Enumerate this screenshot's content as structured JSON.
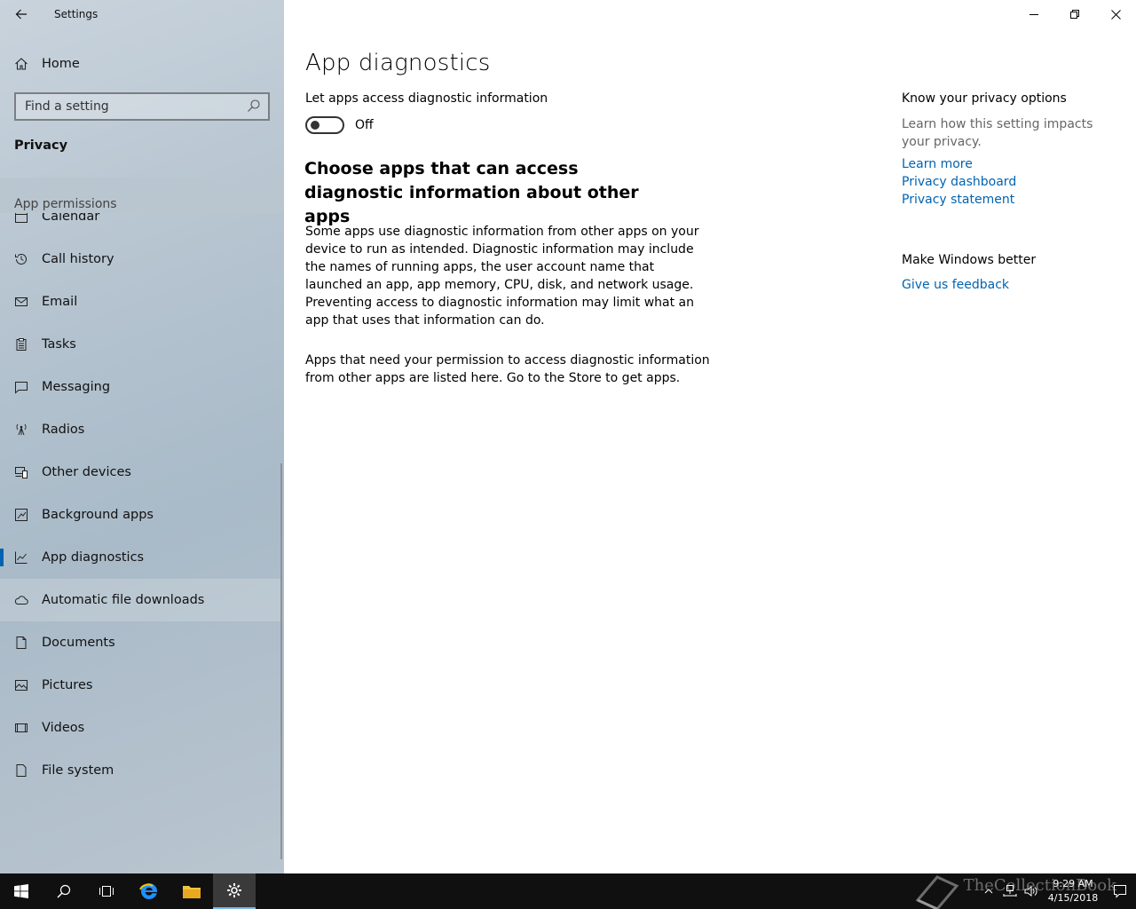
{
  "window": {
    "title": "Settings",
    "controls": {
      "minimize": "minimize-icon",
      "restore": "restore-icon",
      "close": "close-icon"
    }
  },
  "sidebar": {
    "home_label": "Home",
    "search_placeholder": "Find a setting",
    "section_title": "Privacy",
    "group_title": "App permissions",
    "items": [
      {
        "label": "Calendar",
        "icon": "calendar-icon"
      },
      {
        "label": "Call history",
        "icon": "history-icon"
      },
      {
        "label": "Email",
        "icon": "mail-icon"
      },
      {
        "label": "Tasks",
        "icon": "clipboard-icon"
      },
      {
        "label": "Messaging",
        "icon": "chat-icon"
      },
      {
        "label": "Radios",
        "icon": "antenna-icon"
      },
      {
        "label": "Other devices",
        "icon": "devices-icon"
      },
      {
        "label": "Background apps",
        "icon": "background-apps-icon"
      },
      {
        "label": "App diagnostics",
        "icon": "diagnostics-chart-icon",
        "selected": true
      },
      {
        "label": "Automatic file downloads",
        "icon": "cloud-icon",
        "hovered": true
      },
      {
        "label": "Documents",
        "icon": "document-icon"
      },
      {
        "label": "Pictures",
        "icon": "picture-icon"
      },
      {
        "label": "Videos",
        "icon": "video-icon"
      },
      {
        "label": "File system",
        "icon": "file-icon"
      }
    ]
  },
  "main": {
    "title": "App diagnostics",
    "toggle_label": "Let apps access diagnostic information",
    "toggle_state": "Off",
    "toggle_on": false,
    "sub_heading": "Choose apps that can access diagnostic information about other apps",
    "paragraph_1": "Some apps use diagnostic information from other apps on your device to run as intended. Diagnostic information may include the names of running apps, the user account name that launched an app, app memory, CPU, disk, and network usage. Preventing access to diagnostic information may limit what an app that uses that information can do.",
    "paragraph_2": "Apps that need your permission to access diagnostic information from other apps are listed here. Go to the Store to get apps."
  },
  "aside": {
    "privacy_heading": "Know your privacy options",
    "privacy_text": "Learn how this setting impacts your privacy.",
    "links": [
      "Learn more",
      "Privacy dashboard",
      "Privacy statement"
    ],
    "better_heading": "Make Windows better",
    "feedback_link": "Give us feedback"
  },
  "taskbar": {
    "apps": [
      "start-icon",
      "search-icon",
      "task-view-icon",
      "edge-icon",
      "file-explorer-icon",
      "settings-gear-icon"
    ],
    "time": "9:29 AM",
    "date": "4/15/2018",
    "watermark": "TheCollectionBook",
    "accent": "#76b9ed"
  },
  "colors": {
    "accent": "#0063b1",
    "link": "#0063b1"
  }
}
